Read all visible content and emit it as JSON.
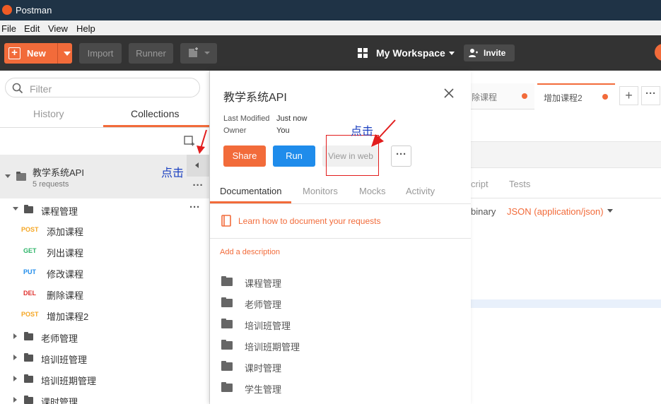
{
  "window": {
    "title": "Postman"
  },
  "menu": [
    "File",
    "Edit",
    "View",
    "Help"
  ],
  "toolbar": {
    "new_label": "New",
    "import_label": "Import",
    "runner_label": "Runner",
    "workspace_label": "My Workspace",
    "invite_label": "Invite"
  },
  "sidebar": {
    "filter_placeholder": "Filter",
    "tabs": [
      "History",
      "Collections"
    ],
    "active_tab": "Collections",
    "collection": {
      "name": "教学系统API",
      "count": "5 requests"
    },
    "folders": [
      {
        "name": "课程管理",
        "expanded": true
      },
      {
        "name": "老师管理",
        "expanded": false
      },
      {
        "name": "培训班管理",
        "expanded": false
      },
      {
        "name": "培训班期管理",
        "expanded": false
      },
      {
        "name": "课时管理",
        "expanded": false
      }
    ],
    "requests": [
      {
        "method": "POST",
        "name": "添加课程",
        "color": "#f5a623"
      },
      {
        "method": "GET",
        "name": "列出课程",
        "color": "#2fb56a"
      },
      {
        "method": "PUT",
        "name": "修改课程",
        "color": "#1f8ceb"
      },
      {
        "method": "DEL",
        "name": "删除课程",
        "color": "#e0322f"
      },
      {
        "method": "POST",
        "name": "增加课程2",
        "color": "#f5a623"
      }
    ]
  },
  "panel": {
    "title": "教学系统API",
    "last_modified_label": "Last Modified",
    "last_modified_value": "Just now",
    "owner_label": "Owner",
    "owner_value": "You",
    "share_label": "Share",
    "run_label": "Run",
    "view_web_label": "View in web",
    "tabs": [
      "Documentation",
      "Monitors",
      "Mocks",
      "Activity"
    ],
    "learn_link": "Learn how to document your requests",
    "add_description": "Add a description",
    "folders": [
      "课程管理",
      "老师管理",
      "培训班管理",
      "培训班期管理",
      "课时管理",
      "学生管理"
    ]
  },
  "background": {
    "tabs": [
      "除课程",
      "增加课程2"
    ],
    "script_label": "cript",
    "tests_label": "Tests",
    "binary_label": "binary",
    "json_label": "JSON (application/json)"
  },
  "annotations": {
    "click1": "点击",
    "click2": "点击"
  },
  "colors": {
    "accent": "#f26b3a",
    "run_blue": "#1f8ceb",
    "annotation": "#1a3fc0",
    "redbox": "#e21d1d"
  }
}
